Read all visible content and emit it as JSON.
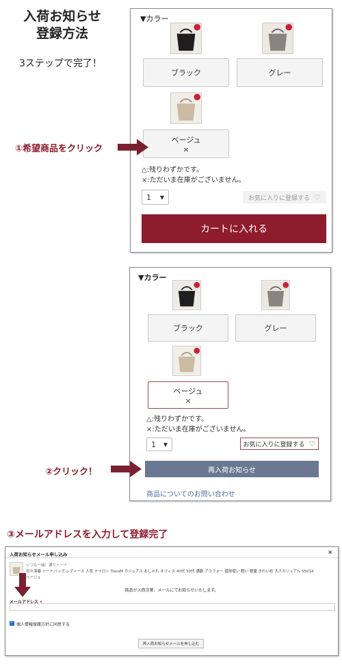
{
  "intro": {
    "title_line1": "入荷お知らせ",
    "title_line2": "登録方法",
    "subtitle": "3ステップで完了！"
  },
  "colors": {
    "accent": "#8e1c2c",
    "notify": "#6a7891",
    "link": "#4d6ea0"
  },
  "panel1": {
    "section_label": "▼カラー",
    "options": [
      {
        "label": "ブラック",
        "mark": "",
        "badge": ""
      },
      {
        "label": "グレー",
        "mark": "",
        "badge": ""
      },
      {
        "label": "ベージュ",
        "mark": "×",
        "badge": ""
      }
    ],
    "stock_legend": [
      "△:残りわずかです。",
      "×:ただいま在庫がございません。"
    ],
    "quantity": "1",
    "favorite_label": "お気に入りに登録する",
    "cart_label": "カートに入れる"
  },
  "step1_label": "①希望商品をクリック",
  "panel2": {
    "section_label": "▼カラー",
    "options": [
      {
        "label": "ブラック",
        "mark": ""
      },
      {
        "label": "グレー",
        "mark": ""
      },
      {
        "label": "ベージュ",
        "mark": "×"
      }
    ],
    "stock_legend": [
      "△:残りわずかです。",
      "×:ただいま在庫がございません。"
    ],
    "quantity": "1",
    "favorite_label": "お気に入りに登録する",
    "notify_label": "再入荷お知らせ",
    "inquiry_label": "商品についてのお問い合わせ"
  },
  "step2_label": "②クリック！",
  "step3_label": "③メールアドレスを入力して登録完了",
  "modal": {
    "title": "入荷お知らせメール申し込み",
    "close": "×",
    "breadcrumb": "いつも一緒！通りトート",
    "product_name": "日々潔癖 トートバッグ レディース 人気 ナイロン TiaraM カジュアル おしゃれ オフィス 40代 50代 通勤 アラフォー 普段使い 軽い 軽量 きれいめ 大人カジュアル S5014",
    "variant": "ベージュ",
    "message": "商品が入荷次第、メールにてお知らせいたします。",
    "email_label": "メールアドレス",
    "email_required": "•",
    "email_value": "",
    "privacy_label": "個人情報保護方針に同意する",
    "submit_label": "再入荷お知らせメールを申し込む"
  }
}
